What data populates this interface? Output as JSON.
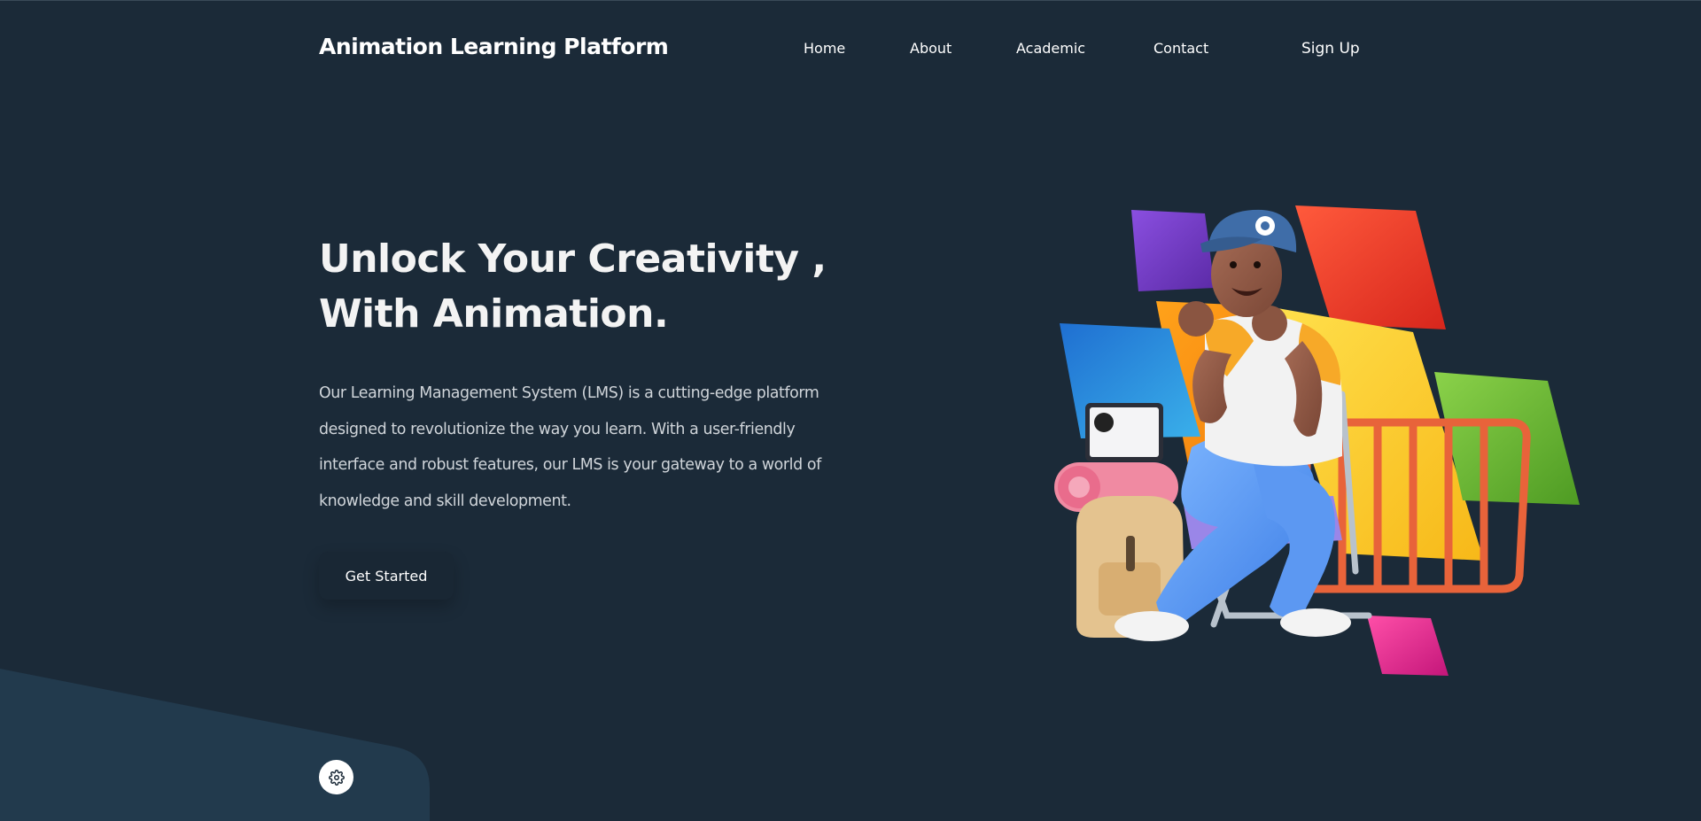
{
  "header": {
    "brand": "Animation Learning Platform",
    "nav": {
      "home": "Home",
      "about": "About",
      "academic": "Academic",
      "contact": "Contact",
      "signup": "Sign Up"
    }
  },
  "hero": {
    "title_line1": "Unlock Your Creativity ,",
    "title_line2": "With Animation.",
    "description": "Our Learning Management System (LMS) is a cutting-edge platform designed to revolutionize the way you learn. With a user-friendly interface and robust features, our LMS is your gateway to a world of knowledge and skill development.",
    "cta_label": "Get Started"
  },
  "widgets": {
    "settings_icon": "gear-icon"
  },
  "colors": {
    "background": "#1b2a38",
    "panel": "#223a4d",
    "text": "#ffffff",
    "muted_text": "#d0d5da"
  }
}
